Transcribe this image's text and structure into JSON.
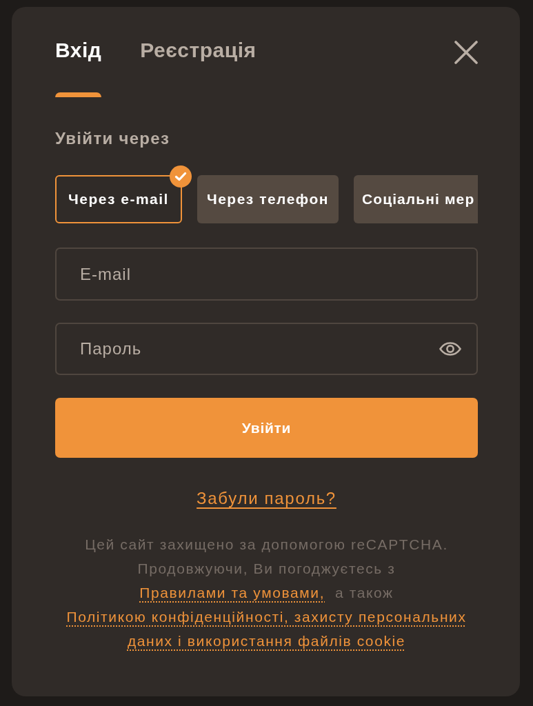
{
  "tabs": [
    {
      "label": "Вхід",
      "selected": true
    },
    {
      "label": "Реєстрація",
      "selected": false
    }
  ],
  "login_via": {
    "title": "Увійти через",
    "methods": [
      {
        "label": "Через e-mail",
        "selected": true
      },
      {
        "label": "Через телефон",
        "selected": false
      },
      {
        "label": "Соціальні мер",
        "selected": false
      }
    ]
  },
  "fields": [
    {
      "kind": "email",
      "placeholder": "E-mail"
    },
    {
      "kind": "password",
      "placeholder": "Пароль"
    }
  ],
  "submit": {
    "label": "Увійти"
  },
  "forgot_link": "Забули пароль?",
  "legal": {
    "sentences": [
      "Цей сайт захищено за допомогою reCAPTCHA.",
      "Продовжуючи, Ви погоджуєтесь з"
    ],
    "terms_link": "Правилами та умовами,",
    "conjunction": "а також",
    "privacy_link_lines": [
      "Політикою конфіденційності, захисту персональних",
      "даних і використання файлів cookie"
    ]
  }
}
